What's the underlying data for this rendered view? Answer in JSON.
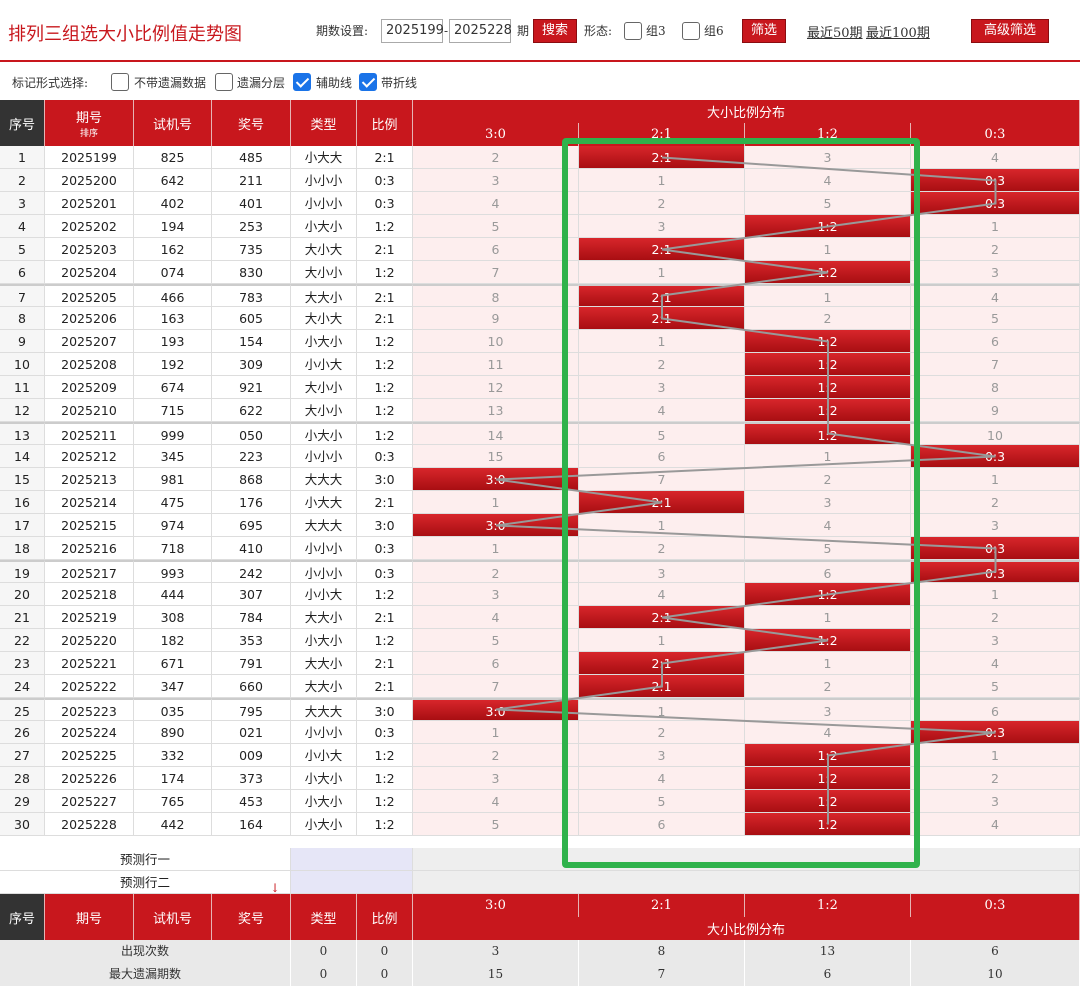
{
  "header": {
    "title": "排列三组选大小比例值走势图",
    "period_label": "期数设置:",
    "period_from": "2025199",
    "period_dash": "-",
    "period_to": "2025228",
    "period_unit": "期",
    "search_label": "搜索",
    "form_label": "形态:",
    "group3_label": "组3",
    "group6_label": "组6",
    "filter_label": "筛选",
    "recent50_label": "最近50期",
    "recent100_label": "最近100期",
    "advanced_label": "高级筛选"
  },
  "mark": {
    "label": "标记形式选择:",
    "opt1": "不带遗漏数据",
    "opt2": "遗漏分层",
    "opt3": "辅助线",
    "opt4": "带折线"
  },
  "table_header": {
    "seq": "序号",
    "period": "期号",
    "sort": "排序",
    "trial": "试机号",
    "prize": "奖号",
    "type": "类型",
    "ratio": "比例",
    "dist": "大小比例分布",
    "cols": [
      "3:0",
      "2:1",
      "1:2",
      "0:3"
    ]
  },
  "rows": [
    {
      "seq": "1",
      "period": "2025199",
      "trial": "825",
      "prize": "485",
      "type": "小大大",
      "ratio": "2:1",
      "dist": [
        "2",
        "2:1",
        "3",
        "4"
      ],
      "hit": 1
    },
    {
      "seq": "2",
      "period": "2025200",
      "trial": "642",
      "prize": "211",
      "type": "小小小",
      "ratio": "0:3",
      "dist": [
        "3",
        "1",
        "4",
        "0:3"
      ],
      "hit": 3
    },
    {
      "seq": "3",
      "period": "2025201",
      "trial": "402",
      "prize": "401",
      "type": "小小小",
      "ratio": "0:3",
      "dist": [
        "4",
        "2",
        "5",
        "0:3"
      ],
      "hit": 3
    },
    {
      "seq": "4",
      "period": "2025202",
      "trial": "194",
      "prize": "253",
      "type": "小大小",
      "ratio": "1:2",
      "dist": [
        "5",
        "3",
        "1:2",
        "1"
      ],
      "hit": 2
    },
    {
      "seq": "5",
      "period": "2025203",
      "trial": "162",
      "prize": "735",
      "type": "大小大",
      "ratio": "2:1",
      "dist": [
        "6",
        "2:1",
        "1",
        "2"
      ],
      "hit": 1
    },
    {
      "seq": "6",
      "period": "2025204",
      "trial": "074",
      "prize": "830",
      "type": "大小小",
      "ratio": "1:2",
      "dist": [
        "7",
        "1",
        "1:2",
        "3"
      ],
      "hit": 2
    },
    {
      "seq": "7",
      "period": "2025205",
      "trial": "466",
      "prize": "783",
      "type": "大大小",
      "ratio": "2:1",
      "dist": [
        "8",
        "2:1",
        "1",
        "4"
      ],
      "hit": 1
    },
    {
      "seq": "8",
      "period": "2025206",
      "trial": "163",
      "prize": "605",
      "type": "大小大",
      "ratio": "2:1",
      "dist": [
        "9",
        "2:1",
        "2",
        "5"
      ],
      "hit": 1
    },
    {
      "seq": "9",
      "period": "2025207",
      "trial": "193",
      "prize": "154",
      "type": "小大小",
      "ratio": "1:2",
      "dist": [
        "10",
        "1",
        "1:2",
        "6"
      ],
      "hit": 2
    },
    {
      "seq": "10",
      "period": "2025208",
      "trial": "192",
      "prize": "309",
      "type": "小小大",
      "ratio": "1:2",
      "dist": [
        "11",
        "2",
        "1:2",
        "7"
      ],
      "hit": 2
    },
    {
      "seq": "11",
      "period": "2025209",
      "trial": "674",
      "prize": "921",
      "type": "大小小",
      "ratio": "1:2",
      "dist": [
        "12",
        "3",
        "1:2",
        "8"
      ],
      "hit": 2
    },
    {
      "seq": "12",
      "period": "2025210",
      "trial": "715",
      "prize": "622",
      "type": "大小小",
      "ratio": "1:2",
      "dist": [
        "13",
        "4",
        "1:2",
        "9"
      ],
      "hit": 2
    },
    {
      "seq": "13",
      "period": "2025211",
      "trial": "999",
      "prize": "050",
      "type": "小大小",
      "ratio": "1:2",
      "dist": [
        "14",
        "5",
        "1:2",
        "10"
      ],
      "hit": 2
    },
    {
      "seq": "14",
      "period": "2025212",
      "trial": "345",
      "prize": "223",
      "type": "小小小",
      "ratio": "0:3",
      "dist": [
        "15",
        "6",
        "1",
        "0:3"
      ],
      "hit": 3
    },
    {
      "seq": "15",
      "period": "2025213",
      "trial": "981",
      "prize": "868",
      "type": "大大大",
      "ratio": "3:0",
      "dist": [
        "3:0",
        "7",
        "2",
        "1"
      ],
      "hit": 0
    },
    {
      "seq": "16",
      "period": "2025214",
      "trial": "475",
      "prize": "176",
      "type": "小大大",
      "ratio": "2:1",
      "dist": [
        "1",
        "2:1",
        "3",
        "2"
      ],
      "hit": 1
    },
    {
      "seq": "17",
      "period": "2025215",
      "trial": "974",
      "prize": "695",
      "type": "大大大",
      "ratio": "3:0",
      "dist": [
        "3:0",
        "1",
        "4",
        "3"
      ],
      "hit": 0
    },
    {
      "seq": "18",
      "period": "2025216",
      "trial": "718",
      "prize": "410",
      "type": "小小小",
      "ratio": "0:3",
      "dist": [
        "1",
        "2",
        "5",
        "0:3"
      ],
      "hit": 3
    },
    {
      "seq": "19",
      "period": "2025217",
      "trial": "993",
      "prize": "242",
      "type": "小小小",
      "ratio": "0:3",
      "dist": [
        "2",
        "3",
        "6",
        "0:3"
      ],
      "hit": 3
    },
    {
      "seq": "20",
      "period": "2025218",
      "trial": "444",
      "prize": "307",
      "type": "小小大",
      "ratio": "1:2",
      "dist": [
        "3",
        "4",
        "1:2",
        "1"
      ],
      "hit": 2
    },
    {
      "seq": "21",
      "period": "2025219",
      "trial": "308",
      "prize": "784",
      "type": "大大小",
      "ratio": "2:1",
      "dist": [
        "4",
        "2:1",
        "1",
        "2"
      ],
      "hit": 1
    },
    {
      "seq": "22",
      "period": "2025220",
      "trial": "182",
      "prize": "353",
      "type": "小大小",
      "ratio": "1:2",
      "dist": [
        "5",
        "1",
        "1:2",
        "3"
      ],
      "hit": 2
    },
    {
      "seq": "23",
      "period": "2025221",
      "trial": "671",
      "prize": "791",
      "type": "大大小",
      "ratio": "2:1",
      "dist": [
        "6",
        "2:1",
        "1",
        "4"
      ],
      "hit": 1
    },
    {
      "seq": "24",
      "period": "2025222",
      "trial": "347",
      "prize": "660",
      "type": "大大小",
      "ratio": "2:1",
      "dist": [
        "7",
        "2:1",
        "2",
        "5"
      ],
      "hit": 1
    },
    {
      "seq": "25",
      "period": "2025223",
      "trial": "035",
      "prize": "795",
      "type": "大大大",
      "ratio": "3:0",
      "dist": [
        "3:0",
        "1",
        "3",
        "6"
      ],
      "hit": 0
    },
    {
      "seq": "26",
      "period": "2025224",
      "trial": "890",
      "prize": "021",
      "type": "小小小",
      "ratio": "0:3",
      "dist": [
        "1",
        "2",
        "4",
        "0:3"
      ],
      "hit": 3
    },
    {
      "seq": "27",
      "period": "2025225",
      "trial": "332",
      "prize": "009",
      "type": "小小大",
      "ratio": "1:2",
      "dist": [
        "2",
        "3",
        "1:2",
        "1"
      ],
      "hit": 2
    },
    {
      "seq": "28",
      "period": "2025226",
      "trial": "174",
      "prize": "373",
      "type": "小大小",
      "ratio": "1:2",
      "dist": [
        "3",
        "4",
        "1:2",
        "2"
      ],
      "hit": 2
    },
    {
      "seq": "29",
      "period": "2025227",
      "trial": "765",
      "prize": "453",
      "type": "小大小",
      "ratio": "1:2",
      "dist": [
        "4",
        "5",
        "1:2",
        "3"
      ],
      "hit": 2
    },
    {
      "seq": "30",
      "period": "2025228",
      "trial": "442",
      "prize": "164",
      "type": "小大小",
      "ratio": "1:2",
      "dist": [
        "5",
        "6",
        "1:2",
        "4"
      ],
      "hit": 2
    }
  ],
  "predict": {
    "row1": "预测行一",
    "row2": "预测行二"
  },
  "stats": [
    {
      "label": "出现次数",
      "type": "0",
      "ratio": "0",
      "vals": [
        "3",
        "8",
        "13",
        "6"
      ]
    },
    {
      "label": "最大遗漏期数",
      "type": "0",
      "ratio": "0",
      "vals": [
        "15",
        "7",
        "6",
        "10"
      ]
    }
  ],
  "colors": {
    "accent": "#c8171d",
    "highlight_box": "#2fb24b",
    "missing_bg": "#fdeeee"
  }
}
